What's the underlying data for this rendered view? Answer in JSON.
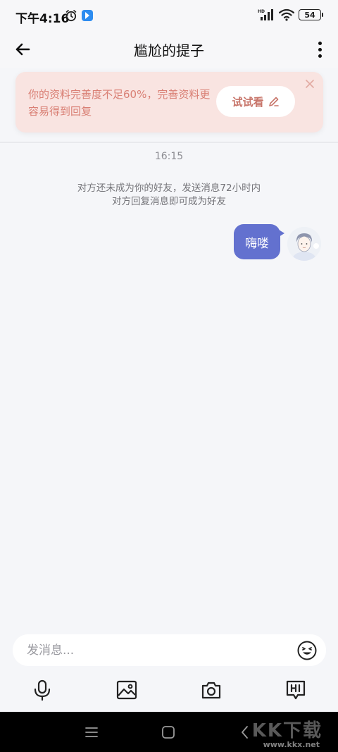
{
  "status_bar": {
    "time": "下午4:16",
    "battery": "54",
    "network": "HD"
  },
  "nav": {
    "title": "尴尬的提子"
  },
  "banner": {
    "text": "你的资料完善度不足60%，完善资料更容易得到回复",
    "button_label": "试试看"
  },
  "chat": {
    "timestamp": "16:15",
    "system_notice_line1": "对方还未成为你的好友，发送消息72小时内",
    "system_notice_line2": "对方回复消息即可成为好友",
    "messages": [
      {
        "from": "me",
        "text": "嗨喽"
      }
    ]
  },
  "composer": {
    "placeholder": "发消息..."
  },
  "toolbar": {
    "items": [
      "mic-icon",
      "image-icon",
      "camera-icon",
      "hi-icon"
    ]
  },
  "watermark": {
    "brand": "KK下载",
    "url": "www.kkx.net"
  },
  "colors": {
    "accent": "#6371cf",
    "banner_bg": "#f9e4e1",
    "banner_text": "#d97f74"
  }
}
